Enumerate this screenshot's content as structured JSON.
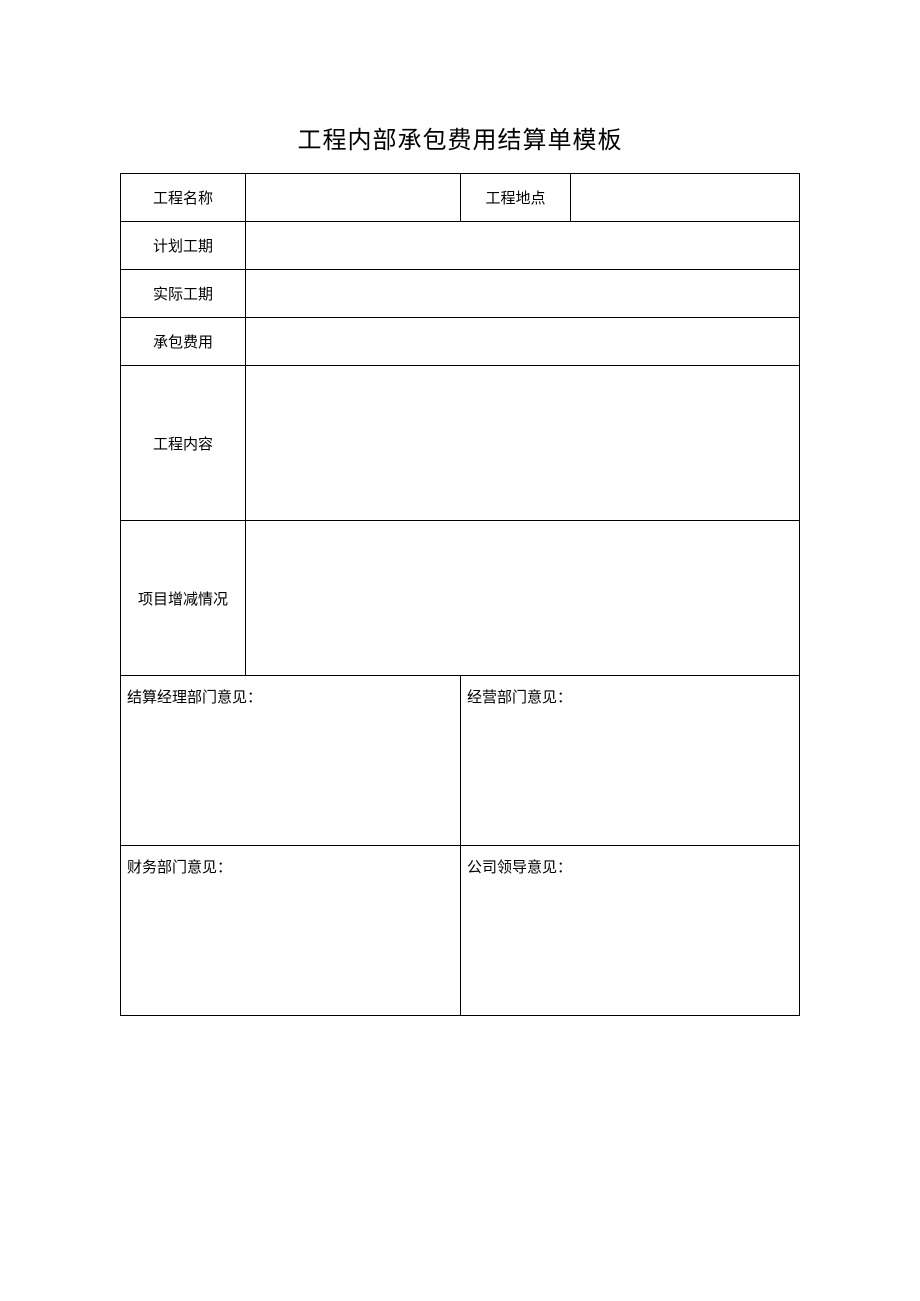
{
  "title": "工程内部承包费用结算单模板",
  "rows": {
    "project_name_label": "工程名称",
    "project_name_value": "",
    "project_location_label": "工程地点",
    "project_location_value": "",
    "planned_duration_label": "计划工期",
    "planned_duration_value": "",
    "actual_duration_label": "实际工期",
    "actual_duration_value": "",
    "contract_fee_label": "承包费用",
    "contract_fee_value": "",
    "project_content_label": "工程内容",
    "project_content_value": "",
    "project_change_label": "项目增减情况",
    "project_change_value": ""
  },
  "opinions": {
    "settlement_manager_label": "结算经理部门意见：",
    "operations_label": "经营部门意见：",
    "finance_label": "财务部门意见：",
    "company_leader_label": "公司领导意见："
  }
}
